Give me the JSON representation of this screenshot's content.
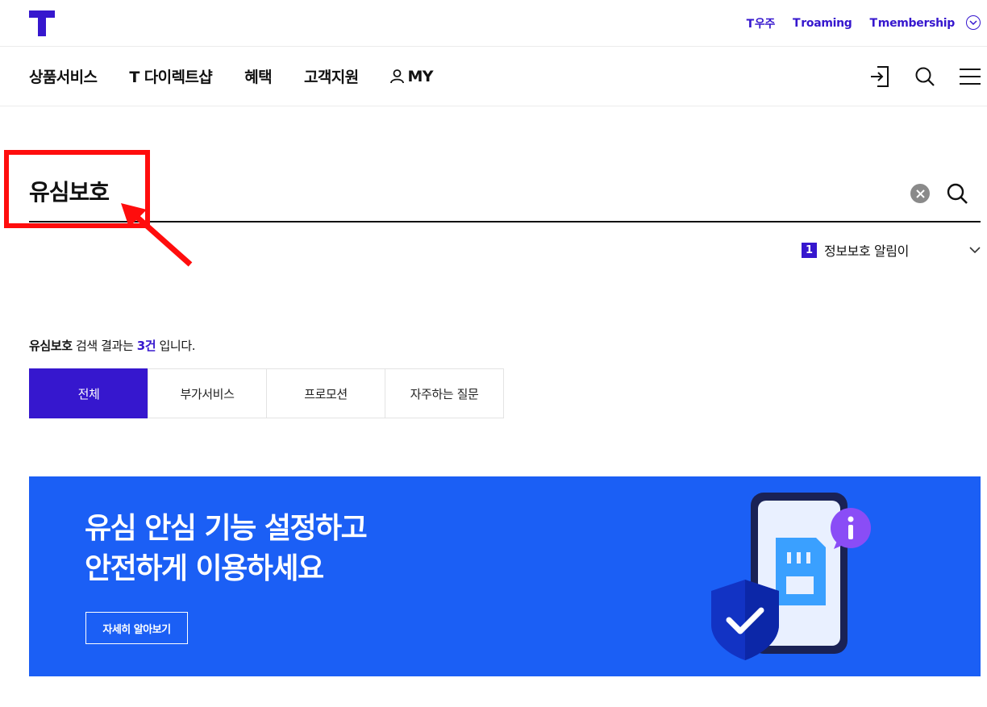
{
  "header": {
    "util_links": [
      {
        "prefix": "T",
        "label": "우주"
      },
      {
        "prefix": "T",
        "label": "roaming"
      },
      {
        "prefix": "T",
        "label": "membership"
      }
    ]
  },
  "nav": {
    "items": [
      "상품서비스",
      "T 다이렉트샵",
      "혜택",
      "고객지원",
      "MY"
    ]
  },
  "search": {
    "query": "유심보호"
  },
  "keyword_rank": {
    "rank": "1",
    "text": "정보보호 알림이"
  },
  "results": {
    "keyword": "유심보호",
    "text_mid": " 검색 결과는 ",
    "count": "3건",
    "text_end": " 입니다."
  },
  "tabs": [
    {
      "label": "전체",
      "active": true
    },
    {
      "label": "부가서비스",
      "active": false
    },
    {
      "label": "프로모션",
      "active": false
    },
    {
      "label": "자주하는 질문",
      "active": false
    }
  ],
  "banner": {
    "title_line1": "유심 안심 기능 설정하고",
    "title_line2": "안전하게 이용하세요",
    "button": "자세히 알아보기",
    "bg_color": "#1b5ff5"
  },
  "colors": {
    "brand": "#3617ce",
    "annotation": "#ff0d0d"
  }
}
